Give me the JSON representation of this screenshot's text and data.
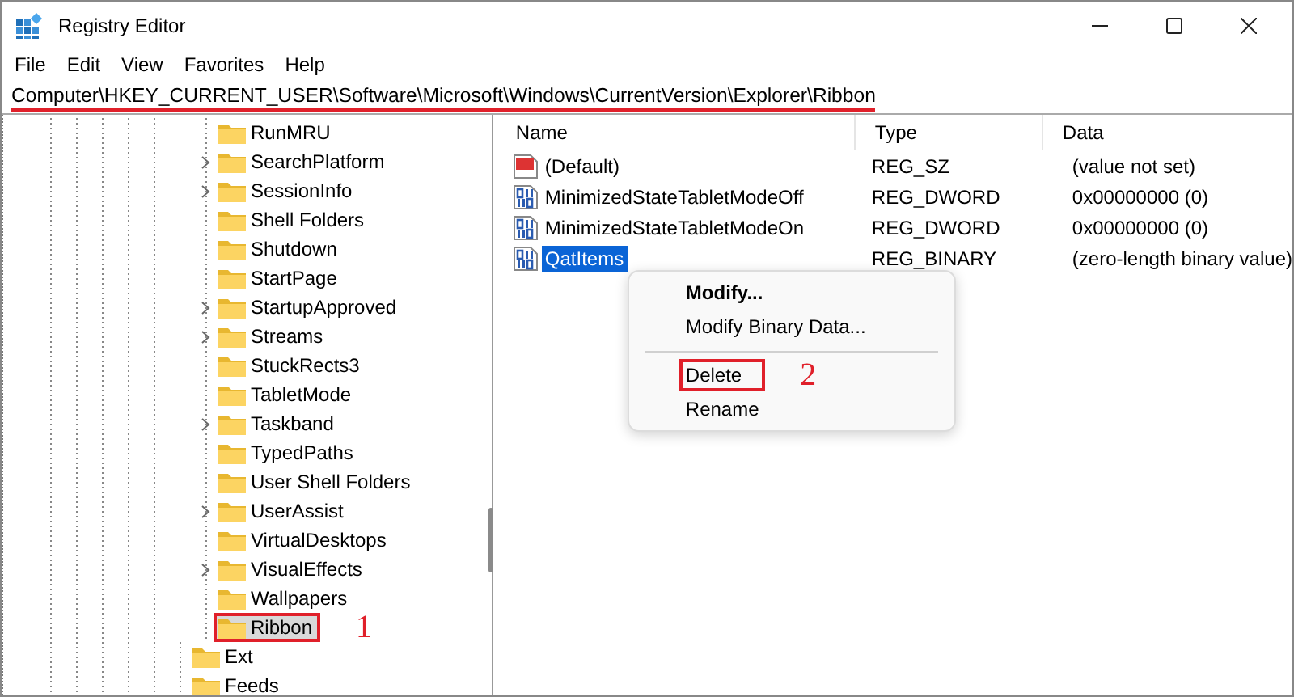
{
  "window": {
    "title": "Registry Editor"
  },
  "menu": [
    "File",
    "Edit",
    "View",
    "Favorites",
    "Help"
  ],
  "address": {
    "path": "Computer\\HKEY_CURRENT_USER\\Software\\Microsoft\\Windows\\CurrentVersion\\Explorer\\Ribbon",
    "marked": true
  },
  "tree": [
    {
      "children": [
        {
          "label": "RunMRU",
          "expandable": false,
          "selected": false,
          "marked": false
        },
        {
          "label": "SearchPlatform",
          "expandable": true,
          "selected": false,
          "marked": false
        },
        {
          "label": "SessionInfo",
          "expandable": true,
          "selected": false,
          "marked": false
        },
        {
          "label": "Shell Folders",
          "expandable": false,
          "selected": false,
          "marked": false
        },
        {
          "label": "Shutdown",
          "expandable": false,
          "selected": false,
          "marked": false
        },
        {
          "label": "StartPage",
          "expandable": false,
          "selected": false,
          "marked": false
        },
        {
          "label": "StartupApproved",
          "expandable": true,
          "selected": false,
          "marked": false
        },
        {
          "label": "Streams",
          "expandable": true,
          "selected": false,
          "marked": false
        },
        {
          "label": "StuckRects3",
          "expandable": false,
          "selected": false,
          "marked": false
        },
        {
          "label": "TabletMode",
          "expandable": false,
          "selected": false,
          "marked": false
        },
        {
          "label": "Taskband",
          "expandable": true,
          "selected": false,
          "marked": false
        },
        {
          "label": "TypedPaths",
          "expandable": false,
          "selected": false,
          "marked": false
        },
        {
          "label": "User Shell Folders",
          "expandable": false,
          "selected": false,
          "marked": false
        },
        {
          "label": "UserAssist",
          "expandable": true,
          "selected": false,
          "marked": false
        },
        {
          "label": "VirtualDesktops",
          "expandable": false,
          "selected": false,
          "marked": false
        },
        {
          "label": "VisualEffects",
          "expandable": true,
          "selected": false,
          "marked": false
        },
        {
          "label": "Wallpapers",
          "expandable": false,
          "selected": false,
          "marked": false
        },
        {
          "label": "Ribbon",
          "expandable": false,
          "selected": true,
          "marked": true,
          "step": "1"
        }
      ]
    },
    {
      "label": "Ext",
      "expandable": false,
      "selected": false,
      "marked": false
    },
    {
      "label": "Feeds",
      "expandable": false,
      "selected": false,
      "marked": false
    }
  ],
  "table": {
    "columns": [
      "Name",
      "Type",
      "Data"
    ],
    "rows": [
      {
        "kind": "string",
        "name": "(Default)",
        "type": "REG_SZ",
        "data": "(value not set)",
        "selected": false
      },
      {
        "kind": "binary",
        "name": "MinimizedStateTabletModeOff",
        "type": "REG_DWORD",
        "data": "0x00000000 (0)",
        "selected": false
      },
      {
        "kind": "binary",
        "name": "MinimizedStateTabletModeOn",
        "type": "REG_DWORD",
        "data": "0x00000000 (0)",
        "selected": false
      },
      {
        "kind": "binary",
        "name": "QatItems",
        "type": "REG_BINARY",
        "data": "(zero-length binary value)",
        "selected": true
      }
    ]
  },
  "context_menu": [
    {
      "kind": "item",
      "label": "Modify...",
      "default": true,
      "marked": false
    },
    {
      "kind": "item",
      "label": "Modify Binary Data...",
      "default": false,
      "marked": false
    },
    {
      "kind": "separator"
    },
    {
      "kind": "item",
      "label": "Delete",
      "default": false,
      "marked": true,
      "step": "2"
    },
    {
      "kind": "item",
      "label": "Rename",
      "default": false,
      "marked": false
    }
  ]
}
